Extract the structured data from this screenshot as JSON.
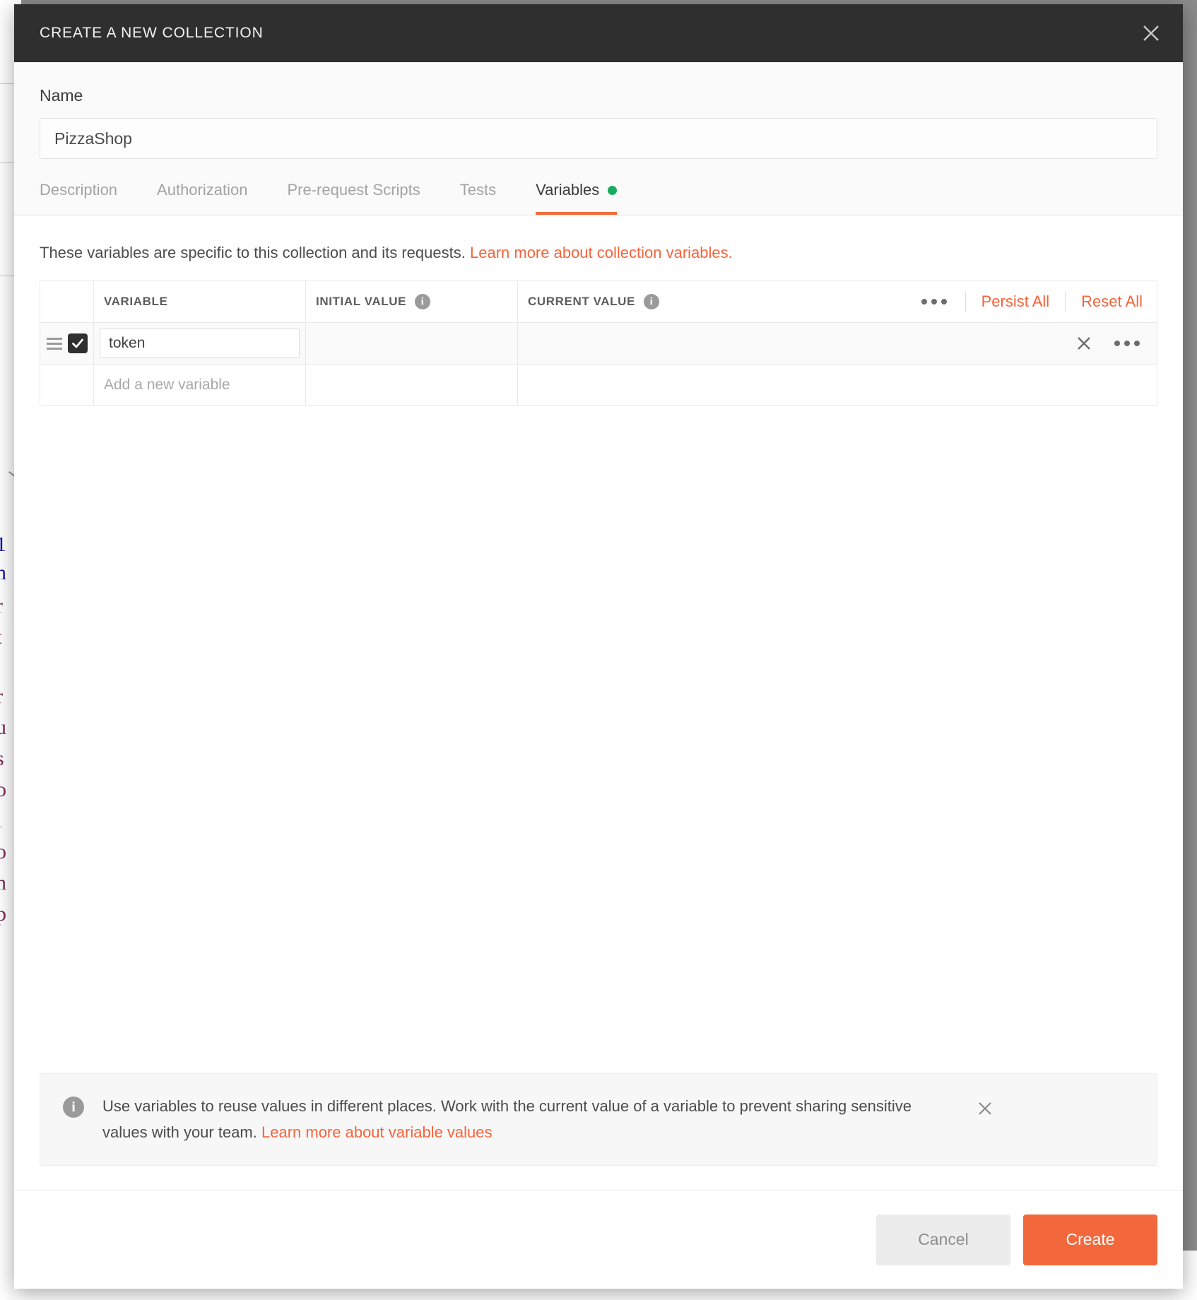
{
  "modal": {
    "title": "CREATE A NEW COLLECTION",
    "close_icon": "close-icon"
  },
  "name_field": {
    "label": "Name",
    "value": "PizzaShop",
    "placeholder": "Name"
  },
  "tabs": [
    {
      "label": "Description",
      "active": false
    },
    {
      "label": "Authorization",
      "active": false
    },
    {
      "label": "Pre-request Scripts",
      "active": false
    },
    {
      "label": "Tests",
      "active": false
    },
    {
      "label": "Variables",
      "active": true,
      "dot_color": "#1bad5f"
    }
  ],
  "variables_pane": {
    "blurb_text": "These variables are specific to this collection and its requests.",
    "blurb_link": "Learn more about collection variables.",
    "table": {
      "headers": {
        "variable": "VARIABLE",
        "initial_value": "INITIAL VALUE",
        "current_value": "CURRENT VALUE"
      },
      "header_actions": {
        "kebab": "more-options",
        "persist_all": "Persist All",
        "reset_all": "Reset All"
      },
      "rows": [
        {
          "enabled": true,
          "variable": "token",
          "initial_value": "",
          "current_value": "",
          "delete_icon": "close-icon",
          "kebab_icon": "more-options-icon"
        }
      ],
      "new_row_placeholder": "Add a new variable"
    },
    "info_banner": {
      "text_before": "Use variables to reuse values in different places. Work with the current value of a variable to prevent sharing sensitive values with your team. ",
      "link": "Learn more about variable values",
      "close_icon": "close-icon"
    }
  },
  "footer": {
    "cancel_label": "Cancel",
    "create_label": "Create"
  },
  "colors": {
    "accent": "#f2683c",
    "link": "#f4643c",
    "header_bg": "#2f2f2f",
    "active_tab_underline": "#f26b3a",
    "status_dot": "#1bad5f"
  },
  "background_page": {
    "fragments": [
      "1",
      "n",
      "r",
      "t",
      "r",
      "u",
      "s",
      "o",
      "i",
      "o",
      "n",
      "p"
    ]
  }
}
